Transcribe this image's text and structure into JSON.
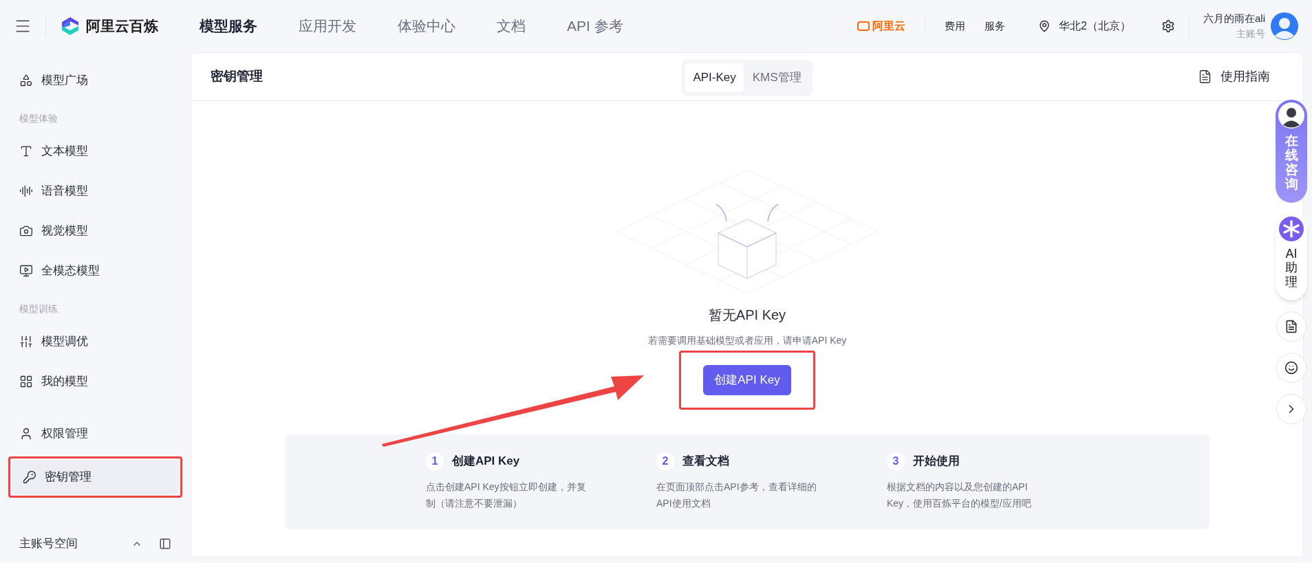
{
  "top_bar": {
    "app_name": "阿里云百炼",
    "nav": [
      {
        "label": "模型服务",
        "selected": true
      },
      {
        "label": "应用开发",
        "selected": false
      },
      {
        "label": "体验中心",
        "selected": false
      },
      {
        "label": "文档",
        "selected": false
      },
      {
        "label": "API 参考",
        "selected": false
      }
    ],
    "brand": "阿里云",
    "links": [
      "费用",
      "服务"
    ],
    "region": "华北2（北京）",
    "user": {
      "name": "六月的雨在ali",
      "role": "主账号"
    }
  },
  "sidebar": {
    "items": [
      {
        "kind": "item",
        "label": "模型广场",
        "selected": false
      },
      {
        "kind": "section",
        "label": "模型体验"
      },
      {
        "kind": "item",
        "label": "文本模型",
        "selected": false
      },
      {
        "kind": "item",
        "label": "语音模型",
        "selected": false
      },
      {
        "kind": "item",
        "label": "视觉模型",
        "selected": false
      },
      {
        "kind": "item",
        "label": "全模态模型",
        "selected": false
      },
      {
        "kind": "section",
        "label": "模型训练"
      },
      {
        "kind": "item",
        "label": "模型调优",
        "selected": false
      },
      {
        "kind": "item",
        "label": "我的模型",
        "selected": false
      },
      {
        "kind": "gap"
      },
      {
        "kind": "item",
        "label": "权限管理",
        "selected": false
      },
      {
        "kind": "item",
        "label": "密钥管理",
        "selected": true
      }
    ],
    "footer": "主账号空间"
  },
  "page": {
    "title": "密钥管理",
    "tabs": [
      {
        "label": "API-Key",
        "selected": true
      },
      {
        "label": "KMS管理",
        "selected": false
      }
    ],
    "guide": "使用指南"
  },
  "empty_state": {
    "title": "暂无API Key",
    "description": "若需要调用基础模型或者应用，请申请API Key",
    "button": "创建API Key"
  },
  "steps": [
    {
      "number": "1",
      "title": "创建API Key",
      "description": "点击创建API Key按钮立即创建，并复制（请注意不要泄漏）"
    },
    {
      "number": "2",
      "title": "查看文档",
      "description": "在页面顶部点击API参考，查看详细的API使用文档"
    },
    {
      "number": "3",
      "title": "开始使用",
      "description": "根据文档的内容以及您创建的API Key，使用百炼平台的模型/应用吧"
    }
  ],
  "floating": {
    "consult": "在线咨询",
    "assistant": "AI助理"
  }
}
